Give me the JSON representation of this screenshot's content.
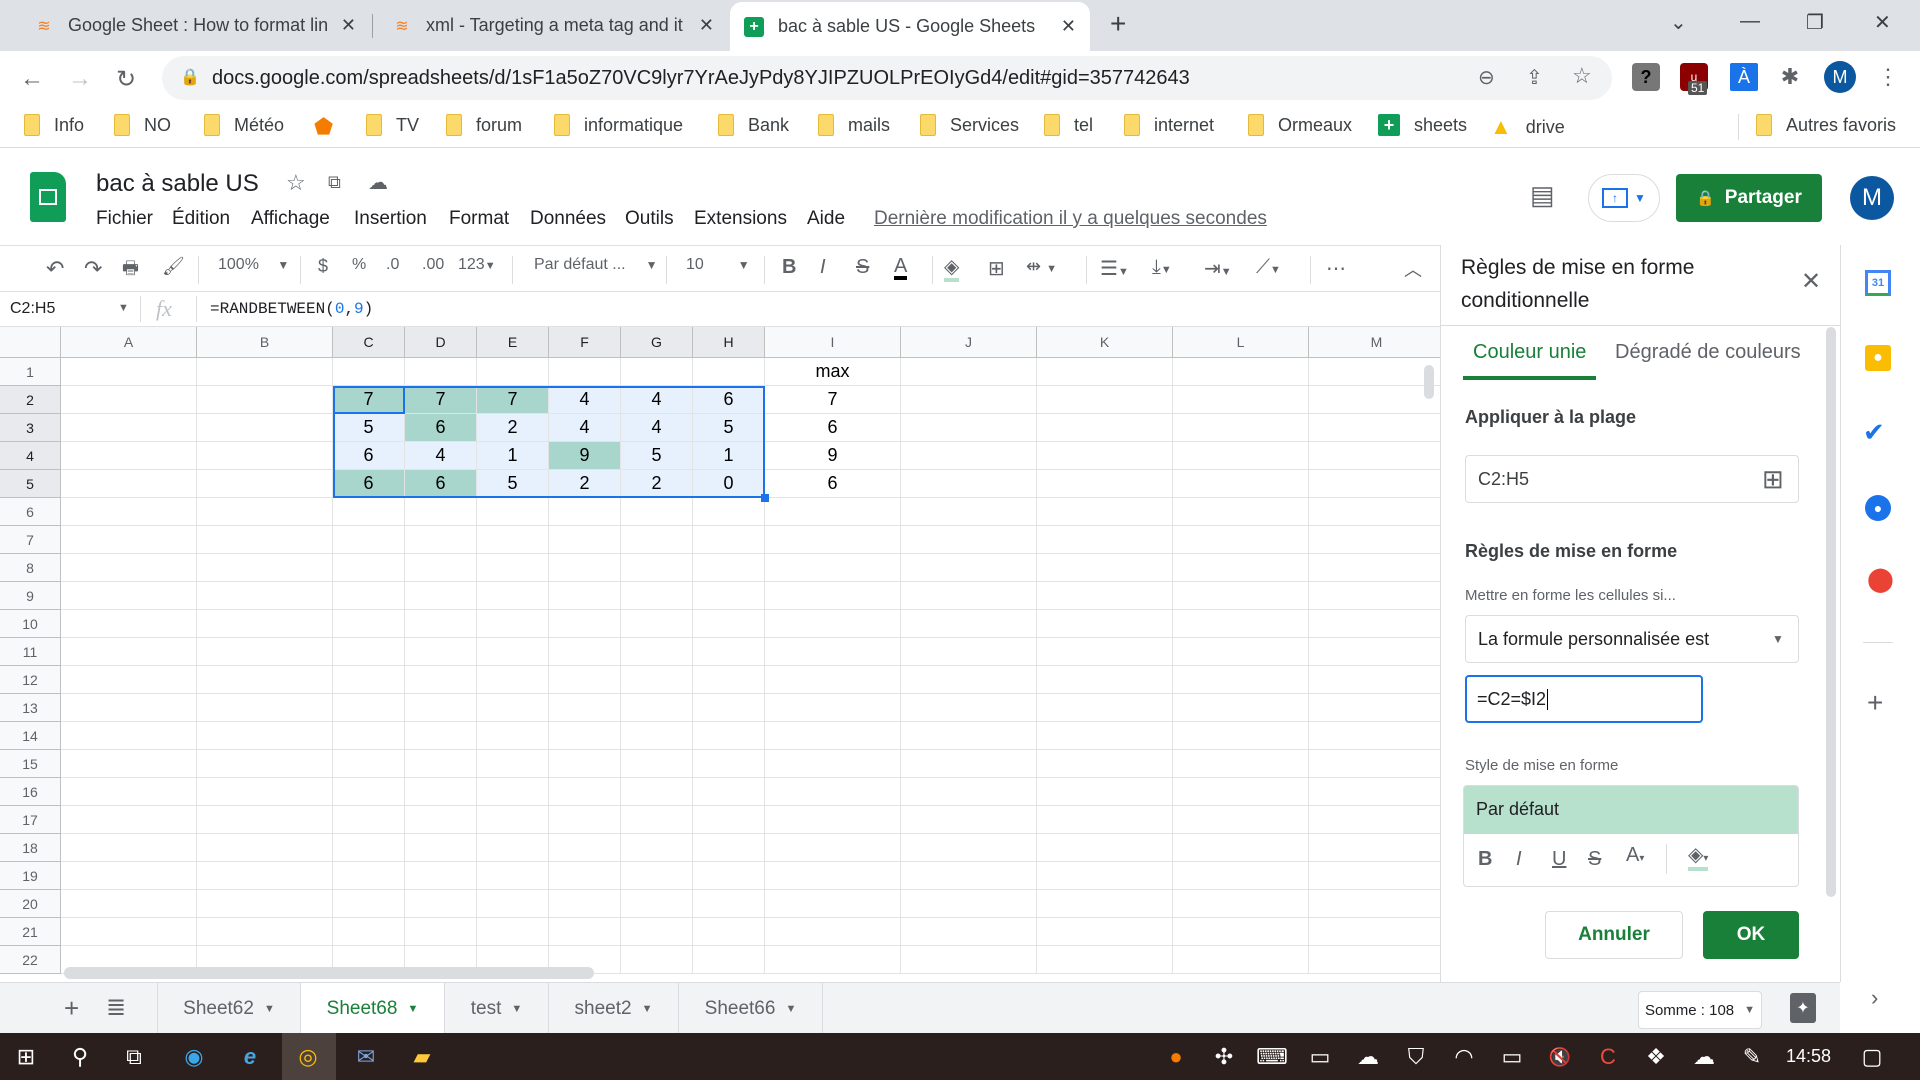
{
  "browser": {
    "tabs": [
      {
        "title": "Google Sheet : How to format lin",
        "icon": "stackoverflow-icon"
      },
      {
        "title": "xml - Targeting a meta tag and it",
        "icon": "stackoverflow-icon"
      },
      {
        "title": "bac à sable US - Google Sheets",
        "icon": "sheets-icon",
        "active": true
      }
    ],
    "new_tab": "+",
    "url": "docs.google.com/spreadsheets/d/1sF1a5oZ70VC9lyr7YrAeJyPdy8YJIPZUOLPrEOIyGd4/edit#gid=357742643",
    "profile_initial": "M",
    "ext_badge": "51",
    "bookmarks": [
      "Info",
      "NO",
      "Météo",
      "",
      "TV",
      "forum",
      "informatique",
      "Bank",
      "mails",
      "Services",
      "tel",
      "internet",
      "Ormeaux",
      "sheets",
      "drive"
    ],
    "other_bookmarks": "Autres favoris"
  },
  "doc": {
    "title": "bac à sable US",
    "menus": [
      "Fichier",
      "Édition",
      "Affichage",
      "Insertion",
      "Format",
      "Données",
      "Outils",
      "Extensions",
      "Aide"
    ],
    "last_edit": "Dernière modification il y a quelques secondes",
    "share_label": "Partager",
    "avatar": "M"
  },
  "toolbar": {
    "zoom": "100%",
    "currency": "$",
    "percent": "%",
    "dec_less": ".0",
    "dec_more": ".00",
    "num_format": "123",
    "font": "Par défaut ...",
    "font_size": "10"
  },
  "formula_bar": {
    "name_box": "C2:H5",
    "fx": "fx",
    "formula_prefix": "=RANDBETWEEN(",
    "arg1": "0",
    "comma": ",",
    "arg2": "9",
    "formula_suffix": ")"
  },
  "grid": {
    "columns": [
      "A",
      "B",
      "C",
      "D",
      "E",
      "F",
      "G",
      "H",
      "I",
      "J",
      "K",
      "L",
      "M"
    ],
    "rows": [
      "1",
      "2",
      "3",
      "4",
      "5",
      "6",
      "7",
      "8",
      "9",
      "10",
      "11",
      "12",
      "13",
      "14",
      "15",
      "16",
      "17",
      "18",
      "19",
      "20",
      "21",
      "22"
    ],
    "i1": "max",
    "data": [
      [
        "7",
        "7",
        "7",
        "4",
        "4",
        "6"
      ],
      [
        "5",
        "6",
        "2",
        "4",
        "4",
        "5"
      ],
      [
        "6",
        "4",
        "1",
        "9",
        "5",
        "1"
      ],
      [
        "6",
        "6",
        "5",
        "2",
        "2",
        "0"
      ]
    ],
    "max": [
      "7",
      "6",
      "9",
      "6"
    ],
    "highlight": [
      [
        true,
        true,
        true,
        false,
        false,
        false
      ],
      [
        false,
        true,
        false,
        false,
        false,
        false
      ],
      [
        false,
        false,
        false,
        true,
        false,
        false
      ],
      [
        true,
        true,
        false,
        false,
        false,
        false
      ]
    ],
    "highlight_color": "#a8d5cc",
    "selection_color": "#e7f0fd"
  },
  "panel": {
    "title_line1": "Règles de mise en forme",
    "title_line2": "conditionnelle",
    "tab_solid": "Couleur unie",
    "tab_gradient": "Dégradé de couleurs",
    "apply_range_label": "Appliquer à la plage",
    "range_value": "C2:H5",
    "rules_label": "Règles de mise en forme",
    "condition_label": "Mettre en forme les cellules si...",
    "condition_value": "La formule personnalisée est",
    "formula_value": "=C2=$I2",
    "style_label": "Style de mise en forme",
    "style_preview": "Par défaut",
    "cancel": "Annuler",
    "ok": "OK"
  },
  "sheets": {
    "tabs": [
      "Sheet62",
      "Sheet68",
      "test",
      "sheet2",
      "Sheet66"
    ],
    "active": "Sheet68",
    "sum": "Somme : 108"
  },
  "taskbar": {
    "time": "14:58"
  },
  "colors": {
    "green": "#188038",
    "blue": "#1a73e8",
    "highlight": "#a8d5cc"
  }
}
